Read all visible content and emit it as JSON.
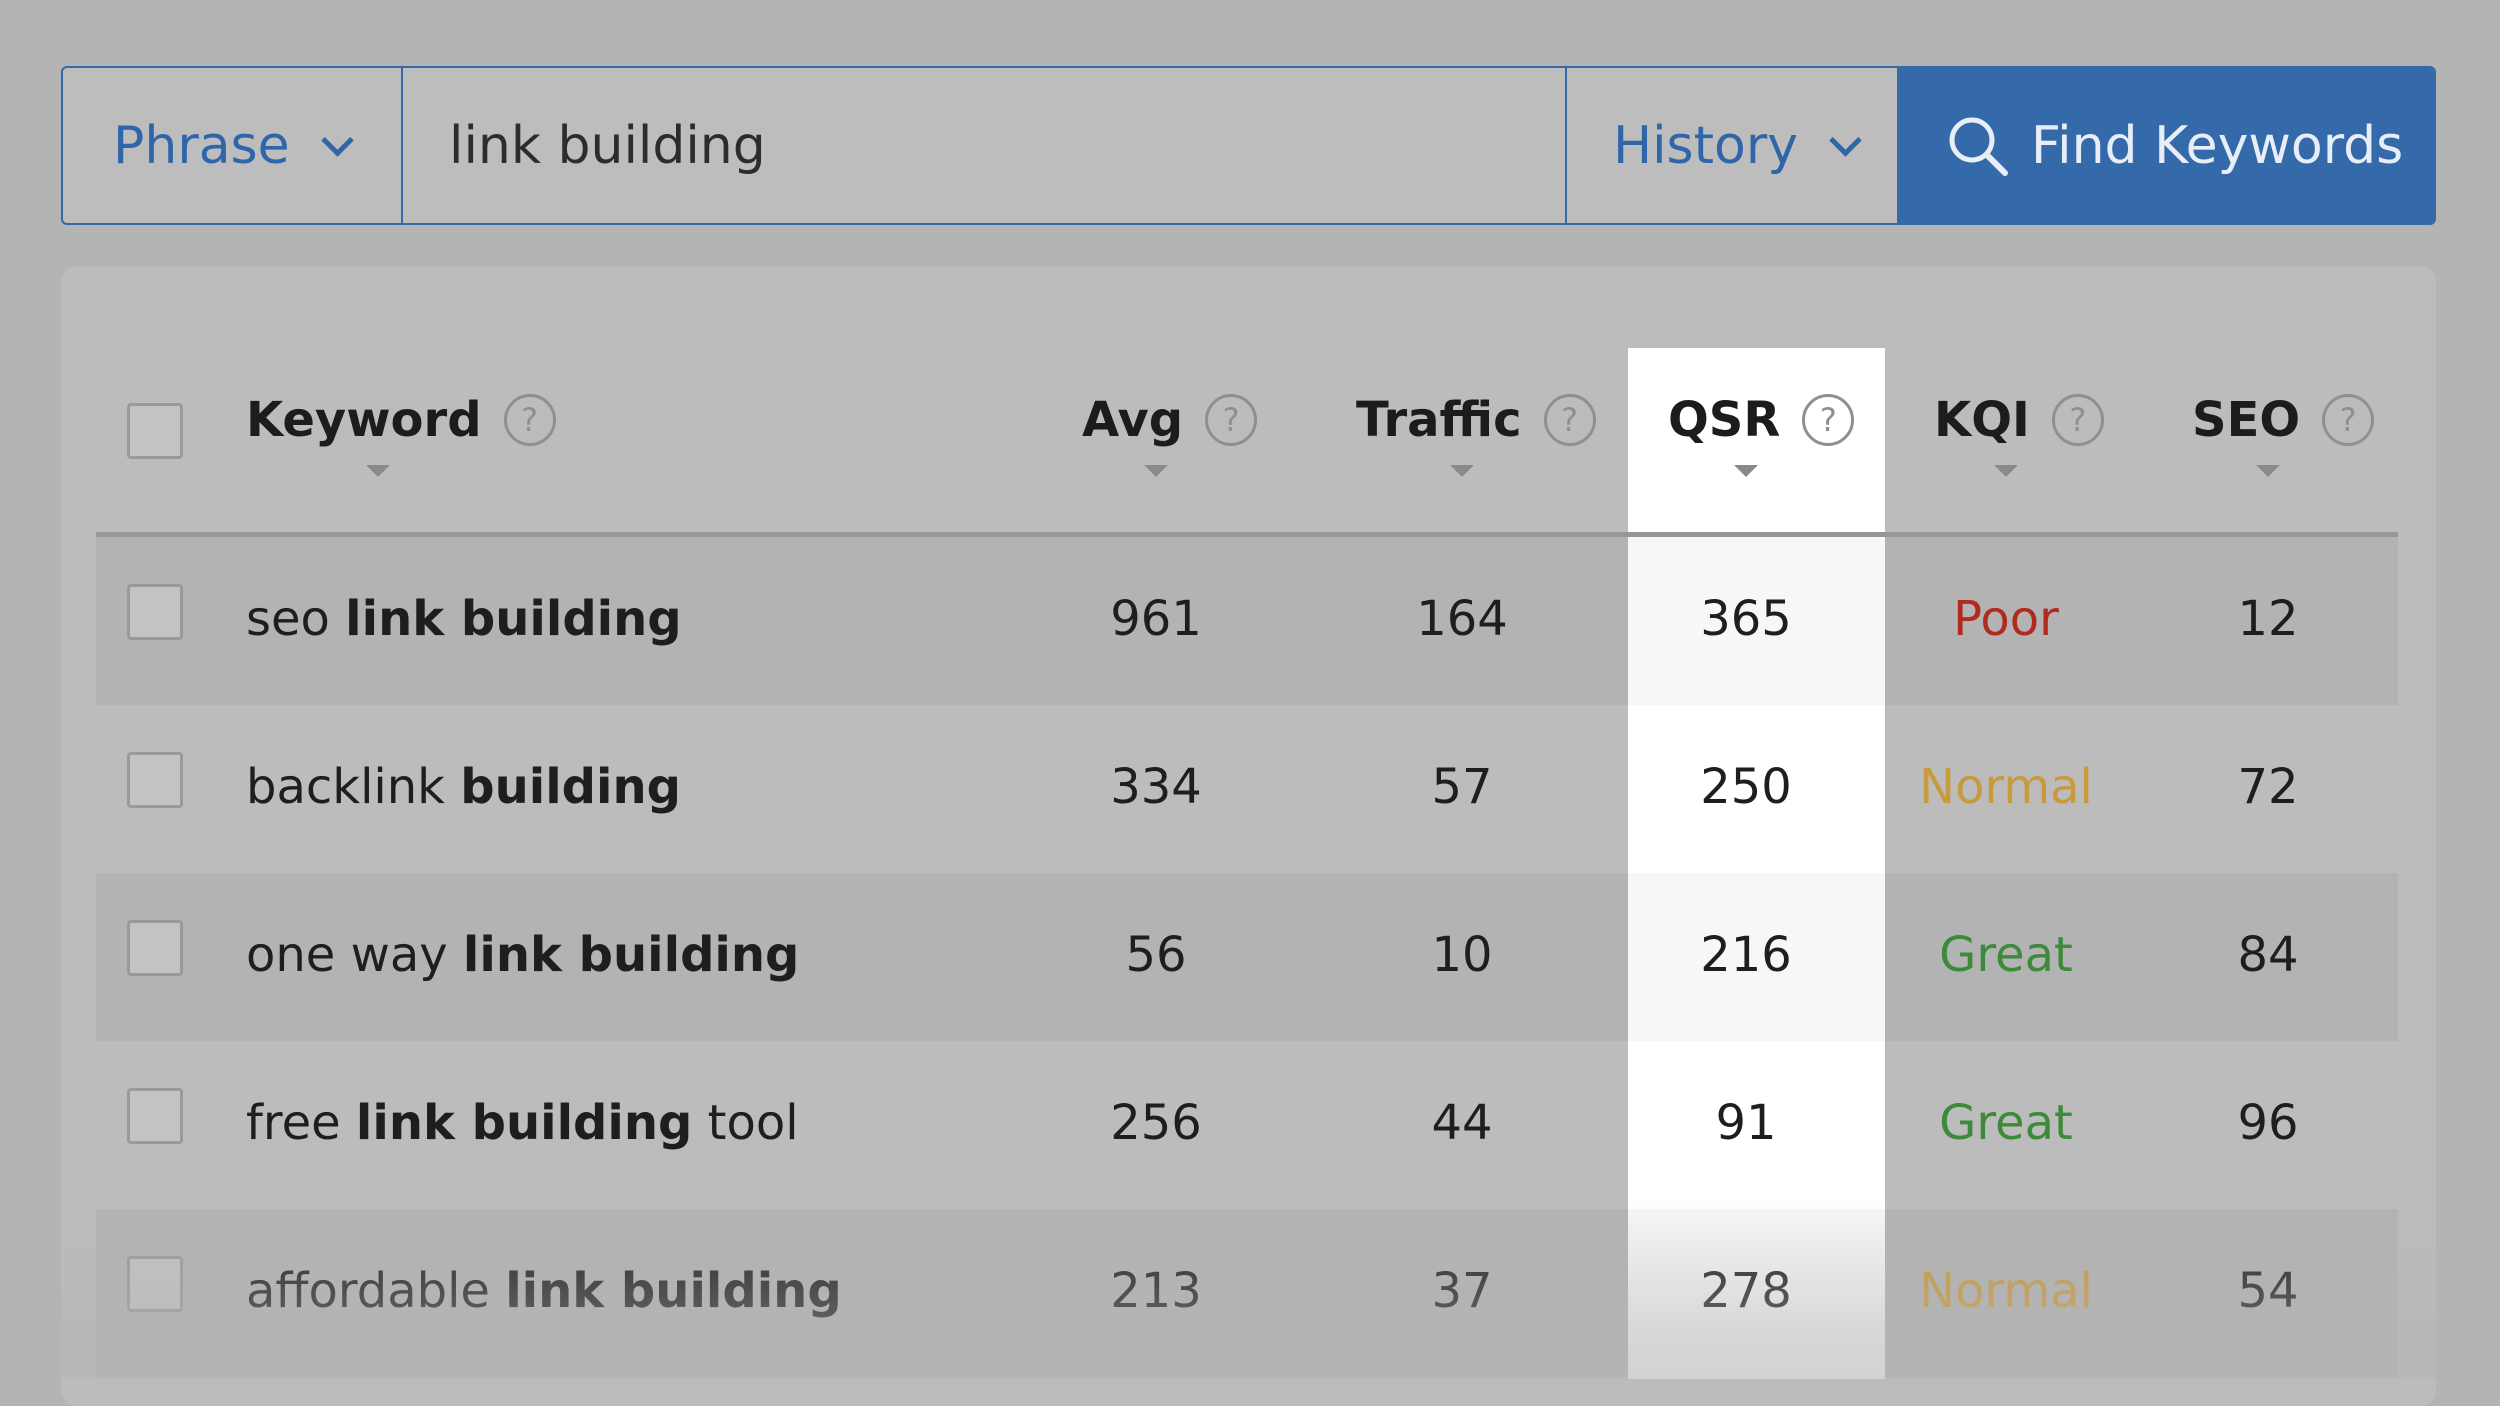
{
  "search": {
    "mode_label": "Phrase",
    "query_value": "link building",
    "history_label": "History",
    "find_label": "Find Keywords"
  },
  "table": {
    "headers": {
      "keyword": "Keyword",
      "avg": "Avg",
      "traffic": "Traffic",
      "qsr": "QSR",
      "kqi": "KQI",
      "seo": "SEO"
    },
    "help_glyph": "?",
    "rows": [
      {
        "kw_pre": "seo ",
        "kw_bold": "link building",
        "kw_post": "",
        "avg": "961",
        "traffic": "164",
        "qsr": "365",
        "kqi": "Poor",
        "seo": "12"
      },
      {
        "kw_pre": "backlink ",
        "kw_bold": "building",
        "kw_post": "",
        "avg": "334",
        "traffic": "57",
        "qsr": "250",
        "kqi": "Normal",
        "seo": "72"
      },
      {
        "kw_pre": "one way ",
        "kw_bold": "link building",
        "kw_post": "",
        "avg": "56",
        "traffic": "10",
        "qsr": "216",
        "kqi": "Great",
        "seo": "84"
      },
      {
        "kw_pre": "free ",
        "kw_bold": "link building",
        "kw_post": " tool",
        "avg": "256",
        "traffic": "44",
        "qsr": "91",
        "kqi": "Great",
        "seo": "96"
      },
      {
        "kw_pre": "affordable ",
        "kw_bold": "link building",
        "kw_post": "",
        "avg": "213",
        "traffic": "37",
        "qsr": "278",
        "kqi": "Normal",
        "seo": "54"
      }
    ]
  },
  "colors": {
    "accent": "#3469aa",
    "kqi_poor": "#b22a1e",
    "kqi_normal": "#c89a3c",
    "kqi_great": "#3c8a3a"
  }
}
